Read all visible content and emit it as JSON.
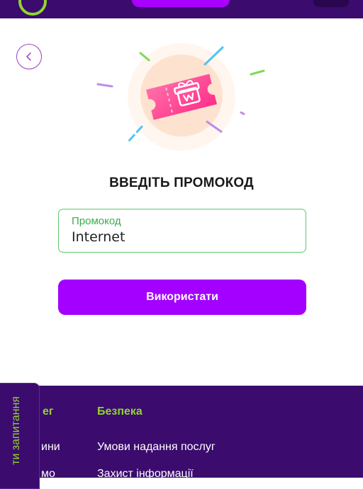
{
  "colors": {
    "header_bg": "#3b0b6e",
    "accent_purple": "#a300ff",
    "accent_green": "#8fd62d",
    "field_border": "#5cc86b"
  },
  "icons": {
    "back": "chevron-left-icon",
    "promo": "ticket-gift-icon"
  },
  "promo": {
    "title": "ВВЕДІТЬ ПРОМОКОД",
    "input_label": "Промокод",
    "input_value": "Internet",
    "submit_label": "Використати"
  },
  "footer": {
    "col1_heading": "ег",
    "col1_items": [
      "ини",
      "мо"
    ],
    "col2_heading": "Безпека",
    "col2_items": [
      "Умови надання послуг",
      "Захист інформації"
    ]
  },
  "side_tab": {
    "label": "ти запитання"
  }
}
